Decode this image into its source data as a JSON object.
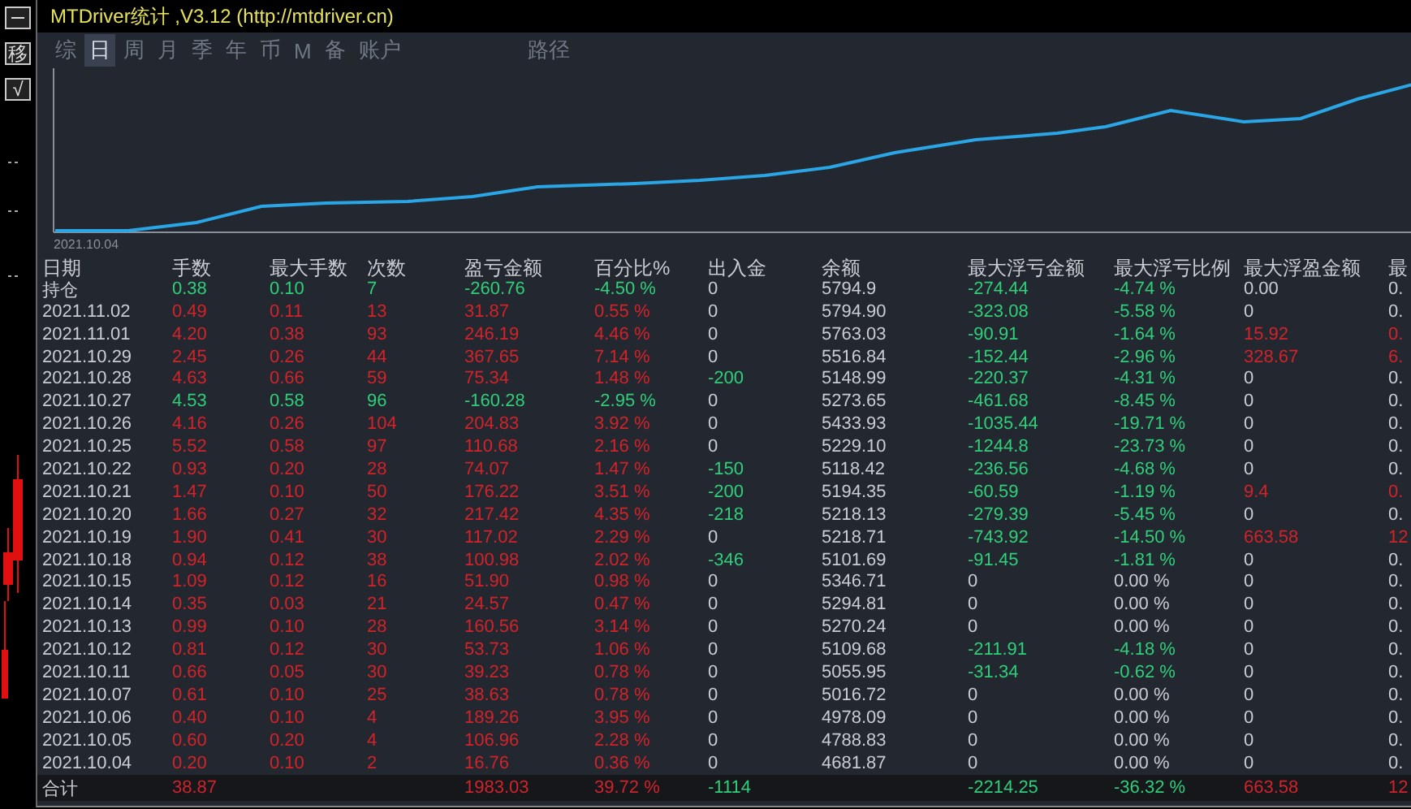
{
  "title": "MTDriver统计 ,V3.12 (http://mtdriver.cn)",
  "side_buttons": [
    "移",
    "√"
  ],
  "tabs": [
    {
      "label": "综",
      "selected": false
    },
    {
      "label": "日",
      "selected": true
    },
    {
      "label": "周",
      "selected": false
    },
    {
      "label": "月",
      "selected": false
    },
    {
      "label": "季",
      "selected": false
    },
    {
      "label": "年",
      "selected": false
    },
    {
      "label": "币",
      "selected": false
    },
    {
      "label": "M",
      "selected": false
    },
    {
      "label": "备",
      "selected": false
    },
    {
      "label": "账户",
      "selected": false
    },
    {
      "label": "路径",
      "selected": false
    }
  ],
  "chart": {
    "start_label": "2021.10.04"
  },
  "table": {
    "columns": [
      "日期",
      "手数",
      "最大手数",
      "次数",
      "盈亏金额",
      "百分比%",
      "出入金",
      "余额",
      "最大浮亏金额",
      "最大浮亏比例",
      "最大浮盈金额",
      "最"
    ],
    "rows": [
      {
        "cells": [
          {
            "text": "持仓",
            "color": "#c9ccd2"
          },
          {
            "text": "0.38",
            "color": "#2fce7a"
          },
          {
            "text": "0.10",
            "color": "#2fce7a"
          },
          {
            "text": "7",
            "color": "#2fce7a"
          },
          {
            "text": "-260.76",
            "color": "#2fce7a"
          },
          {
            "text": "-4.50 %",
            "color": "#2fce7a"
          },
          {
            "text": "0",
            "color": "#c9ccd2"
          },
          {
            "text": "5794.9",
            "color": "#c9ccd2"
          },
          {
            "text": "-274.44",
            "color": "#2fce7a"
          },
          {
            "text": "-4.74 %",
            "color": "#2fce7a"
          },
          {
            "text": "0.00",
            "color": "#c9ccd2"
          },
          {
            "text": "0.",
            "color": "#c9ccd2"
          }
        ]
      },
      {
        "cells": [
          {
            "text": "2021.11.02",
            "color": "#c9ccd2"
          },
          {
            "text": "0.49",
            "color": "#d3232a"
          },
          {
            "text": "0.11",
            "color": "#d3232a"
          },
          {
            "text": "13",
            "color": "#d3232a"
          },
          {
            "text": "31.87",
            "color": "#d3232a"
          },
          {
            "text": "0.55 %",
            "color": "#d3232a"
          },
          {
            "text": "0",
            "color": "#c9ccd2"
          },
          {
            "text": "5794.90",
            "color": "#c9ccd2"
          },
          {
            "text": "-323.08",
            "color": "#2fce7a"
          },
          {
            "text": "-5.58 %",
            "color": "#2fce7a"
          },
          {
            "text": "0",
            "color": "#c9ccd2"
          },
          {
            "text": "0.",
            "color": "#c9ccd2"
          }
        ]
      },
      {
        "cells": [
          {
            "text": "2021.11.01",
            "color": "#c9ccd2"
          },
          {
            "text": "4.20",
            "color": "#d3232a"
          },
          {
            "text": "0.38",
            "color": "#d3232a"
          },
          {
            "text": "93",
            "color": "#d3232a"
          },
          {
            "text": "246.19",
            "color": "#d3232a"
          },
          {
            "text": "4.46 %",
            "color": "#d3232a"
          },
          {
            "text": "0",
            "color": "#c9ccd2"
          },
          {
            "text": "5763.03",
            "color": "#c9ccd2"
          },
          {
            "text": "-90.91",
            "color": "#2fce7a"
          },
          {
            "text": "-1.64 %",
            "color": "#2fce7a"
          },
          {
            "text": "15.92",
            "color": "#d3232a"
          },
          {
            "text": "0.",
            "color": "#d3232a"
          }
        ]
      },
      {
        "cells": [
          {
            "text": "2021.10.29",
            "color": "#c9ccd2"
          },
          {
            "text": "2.45",
            "color": "#d3232a"
          },
          {
            "text": "0.26",
            "color": "#d3232a"
          },
          {
            "text": "44",
            "color": "#d3232a"
          },
          {
            "text": "367.65",
            "color": "#d3232a"
          },
          {
            "text": "7.14 %",
            "color": "#d3232a"
          },
          {
            "text": "0",
            "color": "#c9ccd2"
          },
          {
            "text": "5516.84",
            "color": "#c9ccd2"
          },
          {
            "text": "-152.44",
            "color": "#2fce7a"
          },
          {
            "text": "-2.96 %",
            "color": "#2fce7a"
          },
          {
            "text": "328.67",
            "color": "#d3232a"
          },
          {
            "text": "6.",
            "color": "#d3232a"
          }
        ]
      },
      {
        "cells": [
          {
            "text": "2021.10.28",
            "color": "#c9ccd2"
          },
          {
            "text": "4.63",
            "color": "#d3232a"
          },
          {
            "text": "0.66",
            "color": "#d3232a"
          },
          {
            "text": "59",
            "color": "#d3232a"
          },
          {
            "text": "75.34",
            "color": "#d3232a"
          },
          {
            "text": "1.48 %",
            "color": "#d3232a"
          },
          {
            "text": "-200",
            "color": "#2fce7a"
          },
          {
            "text": "5148.99",
            "color": "#c9ccd2"
          },
          {
            "text": "-220.37",
            "color": "#2fce7a"
          },
          {
            "text": "-4.31 %",
            "color": "#2fce7a"
          },
          {
            "text": "0",
            "color": "#c9ccd2"
          },
          {
            "text": "0.",
            "color": "#c9ccd2"
          }
        ]
      },
      {
        "cells": [
          {
            "text": "2021.10.27",
            "color": "#c9ccd2"
          },
          {
            "text": "4.53",
            "color": "#2fce7a"
          },
          {
            "text": "0.58",
            "color": "#2fce7a"
          },
          {
            "text": "96",
            "color": "#2fce7a"
          },
          {
            "text": "-160.28",
            "color": "#2fce7a"
          },
          {
            "text": "-2.95 %",
            "color": "#2fce7a"
          },
          {
            "text": "0",
            "color": "#c9ccd2"
          },
          {
            "text": "5273.65",
            "color": "#c9ccd2"
          },
          {
            "text": "-461.68",
            "color": "#2fce7a"
          },
          {
            "text": "-8.45 %",
            "color": "#2fce7a"
          },
          {
            "text": "0",
            "color": "#c9ccd2"
          },
          {
            "text": "0.",
            "color": "#c9ccd2"
          }
        ]
      },
      {
        "cells": [
          {
            "text": "2021.10.26",
            "color": "#c9ccd2"
          },
          {
            "text": "4.16",
            "color": "#d3232a"
          },
          {
            "text": "0.26",
            "color": "#d3232a"
          },
          {
            "text": "104",
            "color": "#d3232a"
          },
          {
            "text": "204.83",
            "color": "#d3232a"
          },
          {
            "text": "3.92 %",
            "color": "#d3232a"
          },
          {
            "text": "0",
            "color": "#c9ccd2"
          },
          {
            "text": "5433.93",
            "color": "#c9ccd2"
          },
          {
            "text": "-1035.44",
            "color": "#2fce7a"
          },
          {
            "text": "-19.71 %",
            "color": "#2fce7a"
          },
          {
            "text": "0",
            "color": "#c9ccd2"
          },
          {
            "text": "0.",
            "color": "#c9ccd2"
          }
        ]
      },
      {
        "cells": [
          {
            "text": "2021.10.25",
            "color": "#c9ccd2"
          },
          {
            "text": "5.52",
            "color": "#d3232a"
          },
          {
            "text": "0.58",
            "color": "#d3232a"
          },
          {
            "text": "97",
            "color": "#d3232a"
          },
          {
            "text": "110.68",
            "color": "#d3232a"
          },
          {
            "text": "2.16 %",
            "color": "#d3232a"
          },
          {
            "text": "0",
            "color": "#c9ccd2"
          },
          {
            "text": "5229.10",
            "color": "#c9ccd2"
          },
          {
            "text": "-1244.8",
            "color": "#2fce7a"
          },
          {
            "text": "-23.73 %",
            "color": "#2fce7a"
          },
          {
            "text": "0",
            "color": "#c9ccd2"
          },
          {
            "text": "0.",
            "color": "#c9ccd2"
          }
        ]
      },
      {
        "cells": [
          {
            "text": "2021.10.22",
            "color": "#c9ccd2"
          },
          {
            "text": "0.93",
            "color": "#d3232a"
          },
          {
            "text": "0.20",
            "color": "#d3232a"
          },
          {
            "text": "28",
            "color": "#d3232a"
          },
          {
            "text": "74.07",
            "color": "#d3232a"
          },
          {
            "text": "1.47 %",
            "color": "#d3232a"
          },
          {
            "text": "-150",
            "color": "#2fce7a"
          },
          {
            "text": "5118.42",
            "color": "#c9ccd2"
          },
          {
            "text": "-236.56",
            "color": "#2fce7a"
          },
          {
            "text": "-4.68 %",
            "color": "#2fce7a"
          },
          {
            "text": "0",
            "color": "#c9ccd2"
          },
          {
            "text": "0.",
            "color": "#c9ccd2"
          }
        ]
      },
      {
        "cells": [
          {
            "text": "2021.10.21",
            "color": "#c9ccd2"
          },
          {
            "text": "1.47",
            "color": "#d3232a"
          },
          {
            "text": "0.10",
            "color": "#d3232a"
          },
          {
            "text": "50",
            "color": "#d3232a"
          },
          {
            "text": "176.22",
            "color": "#d3232a"
          },
          {
            "text": "3.51 %",
            "color": "#d3232a"
          },
          {
            "text": "-200",
            "color": "#2fce7a"
          },
          {
            "text": "5194.35",
            "color": "#c9ccd2"
          },
          {
            "text": "-60.59",
            "color": "#2fce7a"
          },
          {
            "text": "-1.19 %",
            "color": "#2fce7a"
          },
          {
            "text": "9.4",
            "color": "#d3232a"
          },
          {
            "text": "0.",
            "color": "#d3232a"
          }
        ]
      },
      {
        "cells": [
          {
            "text": "2021.10.20",
            "color": "#c9ccd2"
          },
          {
            "text": "1.66",
            "color": "#d3232a"
          },
          {
            "text": "0.27",
            "color": "#d3232a"
          },
          {
            "text": "32",
            "color": "#d3232a"
          },
          {
            "text": "217.42",
            "color": "#d3232a"
          },
          {
            "text": "4.35 %",
            "color": "#d3232a"
          },
          {
            "text": "-218",
            "color": "#2fce7a"
          },
          {
            "text": "5218.13",
            "color": "#c9ccd2"
          },
          {
            "text": "-279.39",
            "color": "#2fce7a"
          },
          {
            "text": "-5.45 %",
            "color": "#2fce7a"
          },
          {
            "text": "0",
            "color": "#c9ccd2"
          },
          {
            "text": "0.",
            "color": "#c9ccd2"
          }
        ]
      },
      {
        "cells": [
          {
            "text": "2021.10.19",
            "color": "#c9ccd2"
          },
          {
            "text": "1.90",
            "color": "#d3232a"
          },
          {
            "text": "0.41",
            "color": "#d3232a"
          },
          {
            "text": "30",
            "color": "#d3232a"
          },
          {
            "text": "117.02",
            "color": "#d3232a"
          },
          {
            "text": "2.29 %",
            "color": "#d3232a"
          },
          {
            "text": "0",
            "color": "#c9ccd2"
          },
          {
            "text": "5218.71",
            "color": "#c9ccd2"
          },
          {
            "text": "-743.92",
            "color": "#2fce7a"
          },
          {
            "text": "-14.50 %",
            "color": "#2fce7a"
          },
          {
            "text": "663.58",
            "color": "#d3232a"
          },
          {
            "text": "12",
            "color": "#d3232a"
          }
        ]
      },
      {
        "cells": [
          {
            "text": "2021.10.18",
            "color": "#c9ccd2"
          },
          {
            "text": "0.94",
            "color": "#d3232a"
          },
          {
            "text": "0.12",
            "color": "#d3232a"
          },
          {
            "text": "38",
            "color": "#d3232a"
          },
          {
            "text": "100.98",
            "color": "#d3232a"
          },
          {
            "text": "2.02 %",
            "color": "#d3232a"
          },
          {
            "text": "-346",
            "color": "#2fce7a"
          },
          {
            "text": "5101.69",
            "color": "#c9ccd2"
          },
          {
            "text": "-91.45",
            "color": "#2fce7a"
          },
          {
            "text": "-1.81 %",
            "color": "#2fce7a"
          },
          {
            "text": "0",
            "color": "#c9ccd2"
          },
          {
            "text": "0.",
            "color": "#c9ccd2"
          }
        ]
      },
      {
        "cells": [
          {
            "text": "2021.10.15",
            "color": "#c9ccd2"
          },
          {
            "text": "1.09",
            "color": "#d3232a"
          },
          {
            "text": "0.12",
            "color": "#d3232a"
          },
          {
            "text": "16",
            "color": "#d3232a"
          },
          {
            "text": "51.90",
            "color": "#d3232a"
          },
          {
            "text": "0.98 %",
            "color": "#d3232a"
          },
          {
            "text": "0",
            "color": "#c9ccd2"
          },
          {
            "text": "5346.71",
            "color": "#c9ccd2"
          },
          {
            "text": "0",
            "color": "#c9ccd2"
          },
          {
            "text": "0.00 %",
            "color": "#c9ccd2"
          },
          {
            "text": "0",
            "color": "#c9ccd2"
          },
          {
            "text": "0.",
            "color": "#c9ccd2"
          }
        ]
      },
      {
        "cells": [
          {
            "text": "2021.10.14",
            "color": "#c9ccd2"
          },
          {
            "text": "0.35",
            "color": "#d3232a"
          },
          {
            "text": "0.03",
            "color": "#d3232a"
          },
          {
            "text": "21",
            "color": "#d3232a"
          },
          {
            "text": "24.57",
            "color": "#d3232a"
          },
          {
            "text": "0.47 %",
            "color": "#d3232a"
          },
          {
            "text": "0",
            "color": "#c9ccd2"
          },
          {
            "text": "5294.81",
            "color": "#c9ccd2"
          },
          {
            "text": "0",
            "color": "#c9ccd2"
          },
          {
            "text": "0.00 %",
            "color": "#c9ccd2"
          },
          {
            "text": "0",
            "color": "#c9ccd2"
          },
          {
            "text": "0.",
            "color": "#c9ccd2"
          }
        ]
      },
      {
        "cells": [
          {
            "text": "2021.10.13",
            "color": "#c9ccd2"
          },
          {
            "text": "0.99",
            "color": "#d3232a"
          },
          {
            "text": "0.10",
            "color": "#d3232a"
          },
          {
            "text": "28",
            "color": "#d3232a"
          },
          {
            "text": "160.56",
            "color": "#d3232a"
          },
          {
            "text": "3.14 %",
            "color": "#d3232a"
          },
          {
            "text": "0",
            "color": "#c9ccd2"
          },
          {
            "text": "5270.24",
            "color": "#c9ccd2"
          },
          {
            "text": "0",
            "color": "#c9ccd2"
          },
          {
            "text": "0.00 %",
            "color": "#c9ccd2"
          },
          {
            "text": "0",
            "color": "#c9ccd2"
          },
          {
            "text": "0.",
            "color": "#c9ccd2"
          }
        ]
      },
      {
        "cells": [
          {
            "text": "2021.10.12",
            "color": "#c9ccd2"
          },
          {
            "text": "0.81",
            "color": "#d3232a"
          },
          {
            "text": "0.12",
            "color": "#d3232a"
          },
          {
            "text": "30",
            "color": "#d3232a"
          },
          {
            "text": "53.73",
            "color": "#d3232a"
          },
          {
            "text": "1.06 %",
            "color": "#d3232a"
          },
          {
            "text": "0",
            "color": "#c9ccd2"
          },
          {
            "text": "5109.68",
            "color": "#c9ccd2"
          },
          {
            "text": "-211.91",
            "color": "#2fce7a"
          },
          {
            "text": "-4.18 %",
            "color": "#2fce7a"
          },
          {
            "text": "0",
            "color": "#c9ccd2"
          },
          {
            "text": "0.",
            "color": "#c9ccd2"
          }
        ]
      },
      {
        "cells": [
          {
            "text": "2021.10.11",
            "color": "#c9ccd2"
          },
          {
            "text": "0.66",
            "color": "#d3232a"
          },
          {
            "text": "0.05",
            "color": "#d3232a"
          },
          {
            "text": "30",
            "color": "#d3232a"
          },
          {
            "text": "39.23",
            "color": "#d3232a"
          },
          {
            "text": "0.78 %",
            "color": "#d3232a"
          },
          {
            "text": "0",
            "color": "#c9ccd2"
          },
          {
            "text": "5055.95",
            "color": "#c9ccd2"
          },
          {
            "text": "-31.34",
            "color": "#2fce7a"
          },
          {
            "text": "-0.62 %",
            "color": "#2fce7a"
          },
          {
            "text": "0",
            "color": "#c9ccd2"
          },
          {
            "text": "0.",
            "color": "#c9ccd2"
          }
        ]
      },
      {
        "cells": [
          {
            "text": "2021.10.07",
            "color": "#c9ccd2"
          },
          {
            "text": "0.61",
            "color": "#d3232a"
          },
          {
            "text": "0.10",
            "color": "#d3232a"
          },
          {
            "text": "25",
            "color": "#d3232a"
          },
          {
            "text": "38.63",
            "color": "#d3232a"
          },
          {
            "text": "0.78 %",
            "color": "#d3232a"
          },
          {
            "text": "0",
            "color": "#c9ccd2"
          },
          {
            "text": "5016.72",
            "color": "#c9ccd2"
          },
          {
            "text": "0",
            "color": "#c9ccd2"
          },
          {
            "text": "0.00 %",
            "color": "#c9ccd2"
          },
          {
            "text": "0",
            "color": "#c9ccd2"
          },
          {
            "text": "0.",
            "color": "#c9ccd2"
          }
        ]
      },
      {
        "cells": [
          {
            "text": "2021.10.06",
            "color": "#c9ccd2"
          },
          {
            "text": "0.40",
            "color": "#d3232a"
          },
          {
            "text": "0.10",
            "color": "#d3232a"
          },
          {
            "text": "4",
            "color": "#d3232a"
          },
          {
            "text": "189.26",
            "color": "#d3232a"
          },
          {
            "text": "3.95 %",
            "color": "#d3232a"
          },
          {
            "text": "0",
            "color": "#c9ccd2"
          },
          {
            "text": "4978.09",
            "color": "#c9ccd2"
          },
          {
            "text": "0",
            "color": "#c9ccd2"
          },
          {
            "text": "0.00 %",
            "color": "#c9ccd2"
          },
          {
            "text": "0",
            "color": "#c9ccd2"
          },
          {
            "text": "0.",
            "color": "#c9ccd2"
          }
        ]
      },
      {
        "cells": [
          {
            "text": "2021.10.05",
            "color": "#c9ccd2"
          },
          {
            "text": "0.60",
            "color": "#d3232a"
          },
          {
            "text": "0.20",
            "color": "#d3232a"
          },
          {
            "text": "4",
            "color": "#d3232a"
          },
          {
            "text": "106.96",
            "color": "#d3232a"
          },
          {
            "text": "2.28 %",
            "color": "#d3232a"
          },
          {
            "text": "0",
            "color": "#c9ccd2"
          },
          {
            "text": "4788.83",
            "color": "#c9ccd2"
          },
          {
            "text": "0",
            "color": "#c9ccd2"
          },
          {
            "text": "0.00 %",
            "color": "#c9ccd2"
          },
          {
            "text": "0",
            "color": "#c9ccd2"
          },
          {
            "text": "0.",
            "color": "#c9ccd2"
          }
        ]
      },
      {
        "cells": [
          {
            "text": "2021.10.04",
            "color": "#c9ccd2"
          },
          {
            "text": "0.20",
            "color": "#d3232a"
          },
          {
            "text": "0.10",
            "color": "#d3232a"
          },
          {
            "text": "2",
            "color": "#d3232a"
          },
          {
            "text": "16.76",
            "color": "#d3232a"
          },
          {
            "text": "0.36 %",
            "color": "#d3232a"
          },
          {
            "text": "0",
            "color": "#c9ccd2"
          },
          {
            "text": "4681.87",
            "color": "#c9ccd2"
          },
          {
            "text": "0",
            "color": "#c9ccd2"
          },
          {
            "text": "0.00 %",
            "color": "#c9ccd2"
          },
          {
            "text": "0",
            "color": "#c9ccd2"
          },
          {
            "text": "0.",
            "color": "#c9ccd2"
          }
        ]
      }
    ],
    "total": {
      "cells": [
        {
          "text": "合计",
          "color": "#c9ccd2"
        },
        {
          "text": "38.87",
          "color": "#d3232a"
        },
        null,
        null,
        {
          "text": "1983.03",
          "color": "#d3232a"
        },
        {
          "text": "39.72 %",
          "color": "#d3232a"
        },
        {
          "text": "-1114",
          "color": "#2fce7a"
        },
        null,
        {
          "text": "-2214.25",
          "color": "#2fce7a"
        },
        {
          "text": "-36.32 %",
          "color": "#2fce7a"
        },
        {
          "text": "663.58",
          "color": "#d3232a"
        },
        {
          "text": "12",
          "color": "#d3232a"
        }
      ]
    }
  }
}
